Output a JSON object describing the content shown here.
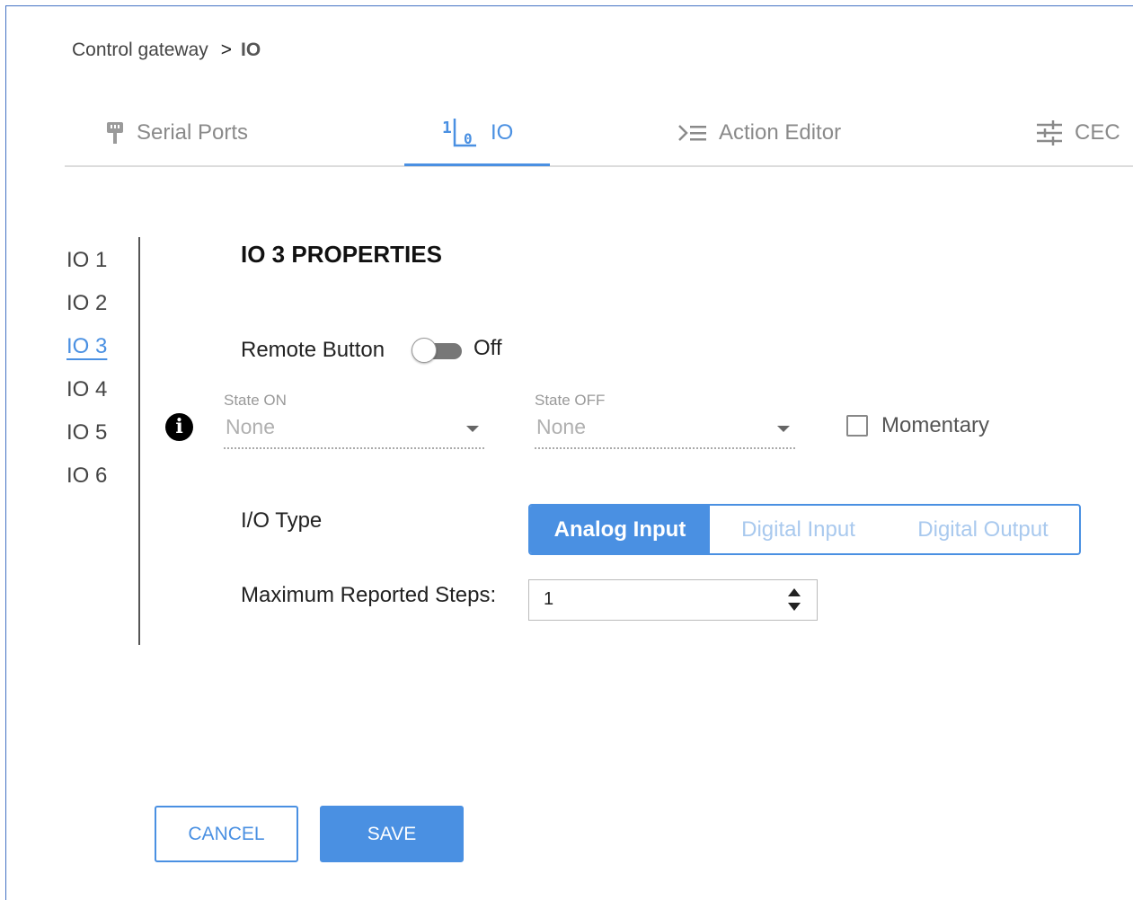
{
  "breadcrumb": {
    "parent": "Control gateway",
    "separator": ">",
    "current": "IO"
  },
  "tabs": [
    {
      "label": "Serial Ports",
      "icon": "serial-port-icon",
      "active": false
    },
    {
      "label": "IO",
      "icon": "io-icon",
      "active": true
    },
    {
      "label": "Action Editor",
      "icon": "action-editor-icon",
      "active": false
    },
    {
      "label": "CEC",
      "icon": "cec-icon",
      "active": false
    }
  ],
  "io_list": [
    "IO 1",
    "IO 2",
    "IO 3",
    "IO 4",
    "IO 5",
    "IO 6"
  ],
  "selected_io": "IO 3",
  "properties": {
    "title": "IO 3 PROPERTIES",
    "remote_button_label": "Remote Button",
    "remote_button_state": "Off",
    "remote_button_on": false,
    "state_on_label": "State ON",
    "state_on_value": "None",
    "state_off_label": "State OFF",
    "state_off_value": "None",
    "momentary_label": "Momentary",
    "momentary_checked": false,
    "io_type_label": "I/O Type",
    "io_type_options": [
      "Analog Input",
      "Digital Input",
      "Digital Output"
    ],
    "io_type_selected": "Analog Input",
    "max_steps_label": "Maximum Reported Steps:",
    "max_steps_value": "1"
  },
  "actions": {
    "cancel": "CANCEL",
    "save": "SAVE"
  },
  "colors": {
    "accent": "#4a90e2",
    "frame": "#4472c4"
  }
}
